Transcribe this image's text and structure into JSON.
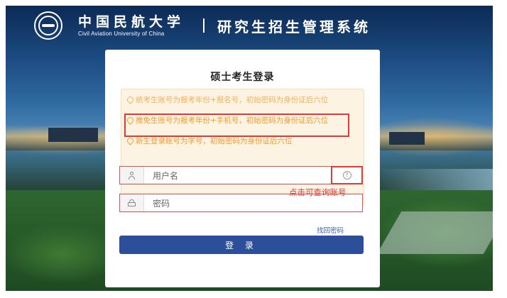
{
  "header": {
    "university_cn": "中国民航大学",
    "university_en": "Civil Aviation University of China",
    "system_title": "研究生招生管理系统"
  },
  "login": {
    "title": "硕士考生登录",
    "notices": [
      "统考生账号为报考年份+报名号，初始密码为身份证后六位",
      "推免生账号为报考年份+手机号，初始密码为身份证后六位",
      "新生登录账号为学号，初始密码为身份证后六位"
    ],
    "username_placeholder": "用户名",
    "password_placeholder": "密码",
    "forgot_password": "找回密码",
    "submit_label": "登 录",
    "help_note": "点击可查询账号"
  }
}
